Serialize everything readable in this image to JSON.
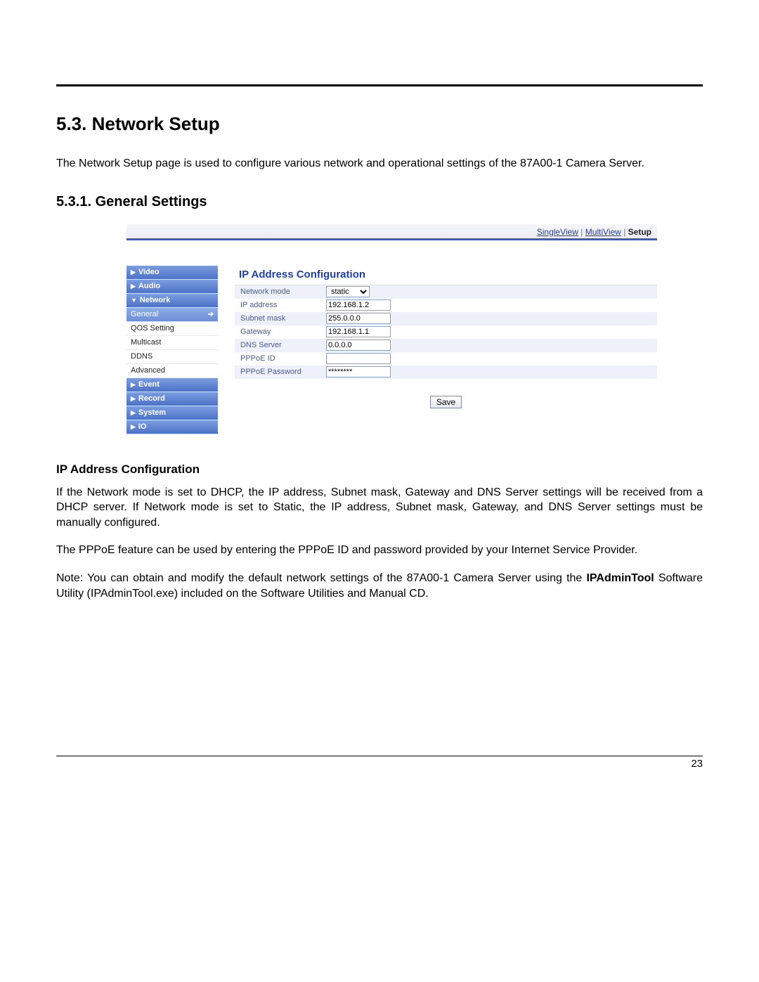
{
  "section_heading": "5.3. Network Setup",
  "intro_text": "The Network Setup page is used to configure various network and operational settings of the 87A00-1 Camera Server.",
  "subsection_heading": "5.3.1. General Settings",
  "tabs": {
    "singleview": "SingleView",
    "multiview": "MultiView",
    "setup": "Setup"
  },
  "sidebar": {
    "video": "Video",
    "audio": "Audio",
    "network": "Network",
    "general": "General",
    "qos": "QOS Setting",
    "multicast": "Multicast",
    "ddns": "DDNS",
    "advanced": "Advanced",
    "event": "Event",
    "record": "Record",
    "system": "System",
    "io": "IO"
  },
  "panel_title": "IP Address Configuration",
  "fields": {
    "network_mode": {
      "label": "Network mode",
      "value": "static"
    },
    "ip_address": {
      "label": "IP address",
      "value": "192.168.1.2"
    },
    "subnet_mask": {
      "label": "Subnet mask",
      "value": "255.0.0.0"
    },
    "gateway": {
      "label": "Gateway",
      "value": "192.168.1.1"
    },
    "dns_server": {
      "label": "DNS Server",
      "value": "0.0.0.0"
    },
    "pppoe_id": {
      "label": "PPPoE ID",
      "value": ""
    },
    "pppoe_pw": {
      "label": "PPPoE Password",
      "value": "********"
    }
  },
  "save_label": "Save",
  "ip_heading": "IP Address Configuration",
  "para1": "If the Network mode is set to DHCP, the IP address, Subnet mask, Gateway and DNS Server settings will be received from a DHCP server.  If Network mode is set to Static, the IP address, Subnet mask, Gateway, and DNS Server settings must be manually configured.",
  "para2": "The PPPoE feature can be used by entering the PPPoE ID and password provided by your Internet Service Provider.",
  "para3_a": "Note: You can obtain and modify the default network settings of the 87A00-1 Camera Server using the ",
  "para3_bold": "IPAdminTool",
  "para3_b": " Software Utility (IPAdminTool.exe) included on the Software Utilities and Manual CD.",
  "page_number": "23"
}
